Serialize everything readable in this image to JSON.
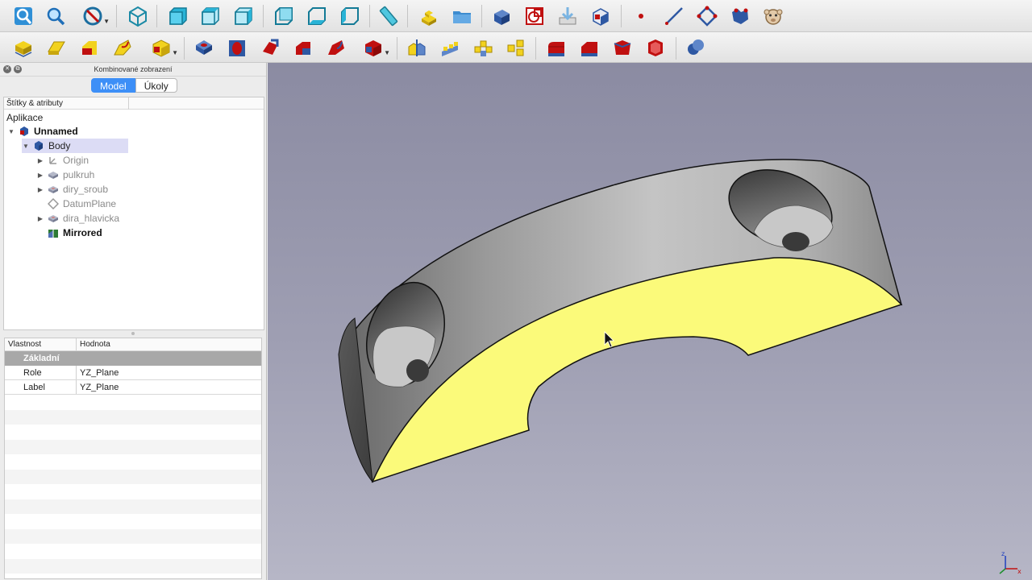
{
  "toolbar_top": {
    "icons": [
      "view-fit-all-icon",
      "view-fit-selection-icon",
      "draw-style-icon",
      "isometric-view-icon",
      "front-view-icon",
      "top-view-icon",
      "right-view-icon",
      "rear-view-icon",
      "bottom-view-icon",
      "left-view-icon",
      "measure-distance-icon",
      "create-part-icon",
      "create-group-icon",
      "create-body-icon",
      "create-sketch-icon",
      "validate-sketch-icon",
      "clone-icon",
      "datum-point-icon",
      "datum-line-icon",
      "datum-plane-icon",
      "shape-binder-icon",
      "sub-shape-binder-icon"
    ]
  },
  "toolbar_bottom": {
    "icons": [
      "pad-icon",
      "revolution-icon",
      "additive-loft-icon",
      "additive-pipe-icon",
      "additive-primitive-icon",
      "pocket-icon",
      "hole-icon",
      "groove-icon",
      "subtractive-loft-icon",
      "subtractive-pipe-icon",
      "subtractive-primitive-icon",
      "mirrored-icon",
      "linear-pattern-icon",
      "polar-pattern-icon",
      "multitransform-icon",
      "fillet-icon",
      "chamfer-icon",
      "draft-icon",
      "thickness-icon",
      "boolean-icon"
    ]
  },
  "combo_view": {
    "title": "Kombinované zobrazení",
    "tabs": [
      {
        "label": "Model"
      },
      {
        "label": "Úkoly"
      }
    ]
  },
  "tree": {
    "header": "Štítky & atributy",
    "root_label": "Aplikace",
    "items": [
      {
        "label": "Unnamed",
        "style": "bold"
      },
      {
        "label": "Body",
        "style": "normal"
      },
      {
        "label": "Origin",
        "style": "gray"
      },
      {
        "label": "pulkruh",
        "style": "gray"
      },
      {
        "label": "diry_sroub",
        "style": "gray"
      },
      {
        "label": "DatumPlane",
        "style": "gray"
      },
      {
        "label": "dira_hlavicka",
        "style": "gray"
      },
      {
        "label": "Mirrored",
        "style": "bold"
      }
    ]
  },
  "properties": {
    "col_property": "Vlastnost",
    "col_value": "Hodnota",
    "group": "Základní",
    "rows": [
      {
        "key": "Role",
        "value": "YZ_Plane"
      },
      {
        "key": "Label",
        "value": "YZ_Plane"
      }
    ]
  },
  "viewport": {
    "face_color": "#fbfa7a",
    "body_color": "#8a8a8a",
    "background_top": "#8b8ba2",
    "background_bottom": "#b6b6c6"
  }
}
